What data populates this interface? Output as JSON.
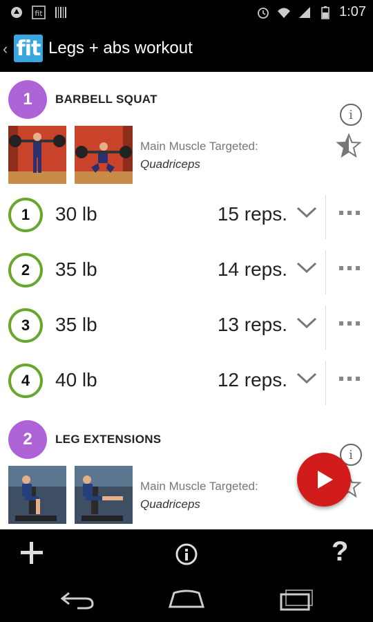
{
  "status_bar": {
    "time": "1:07",
    "icons": [
      "app-notification-icon",
      "fit-notification-icon",
      "barcode-icon",
      "alarm-icon",
      "wifi-icon",
      "signal-icon",
      "battery-icon"
    ]
  },
  "action_bar": {
    "logo_text": "fit",
    "title": "Legs + abs workout"
  },
  "exercises": [
    {
      "number": "1",
      "name": "BARBELL SQUAT",
      "muscle_label": "Main Muscle Targeted:",
      "muscle_value": "Quadriceps",
      "sets": [
        {
          "number": "1",
          "weight": "30 lb",
          "reps": "15 reps."
        },
        {
          "number": "2",
          "weight": "35 lb",
          "reps": "14 reps."
        },
        {
          "number": "3",
          "weight": "35 lb",
          "reps": "13 reps."
        },
        {
          "number": "4",
          "weight": "40 lb",
          "reps": "12 reps."
        }
      ]
    },
    {
      "number": "2",
      "name": "LEG EXTENSIONS",
      "muscle_label": "Main Muscle Targeted:",
      "muscle_value": "Quadriceps"
    }
  ],
  "toolbar": {
    "add_icon": "plus-icon",
    "info_icon": "info-icon",
    "help_label": "?"
  },
  "colors": {
    "exercise_badge": "#ad63d6",
    "set_ring": "#68a72e",
    "fab": "#d21c1c",
    "logo": "#3aa6e0"
  }
}
